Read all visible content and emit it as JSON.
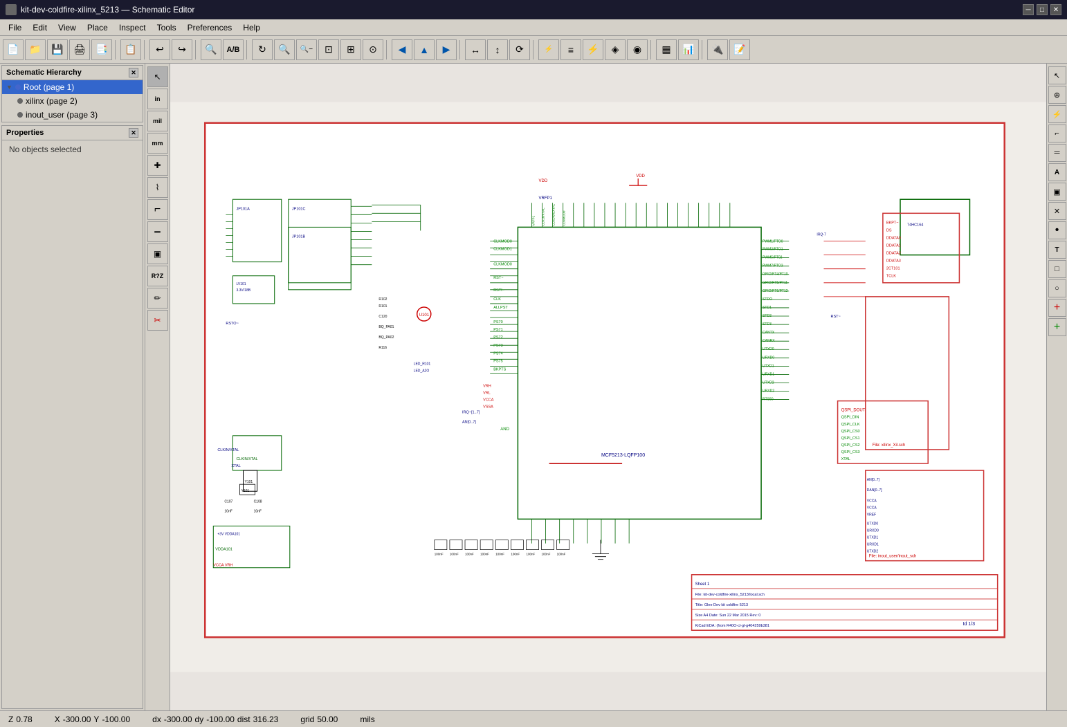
{
  "titlebar": {
    "title": "kit-dev-coldfire-xilinx_5213 — Schematic Editor",
    "icon": "schematic-icon",
    "controls": [
      "minimize",
      "maximize",
      "close"
    ]
  },
  "menubar": {
    "items": [
      "File",
      "Edit",
      "View",
      "Place",
      "Inspect",
      "Tools",
      "Preferences",
      "Help"
    ]
  },
  "toolbar": {
    "buttons": [
      {
        "name": "new",
        "icon": "📄",
        "label": "New"
      },
      {
        "name": "open",
        "icon": "📁",
        "label": "Open"
      },
      {
        "name": "save",
        "icon": "💾",
        "label": "Save"
      },
      {
        "name": "print",
        "icon": "🖨",
        "label": "Print"
      },
      {
        "name": "pdf",
        "icon": "📑",
        "label": "PDF"
      },
      {
        "name": "copy",
        "icon": "📋",
        "label": "Copy"
      },
      {
        "name": "undo",
        "icon": "↩",
        "label": "Undo"
      },
      {
        "name": "redo",
        "icon": "↪",
        "label": "Redo"
      },
      {
        "name": "search",
        "icon": "🔍",
        "label": "Search"
      },
      {
        "name": "annotate",
        "icon": "A",
        "label": "Annotate"
      },
      {
        "name": "refresh",
        "icon": "↻",
        "label": "Refresh"
      },
      {
        "name": "zoom-in",
        "icon": "+",
        "label": "Zoom In"
      },
      {
        "name": "zoom-out",
        "icon": "−",
        "label": "Zoom Out"
      },
      {
        "name": "zoom-fit",
        "icon": "⊡",
        "label": "Zoom Fit"
      },
      {
        "name": "zoom-area",
        "icon": "⊞",
        "label": "Zoom Area"
      },
      {
        "name": "zoom-orig",
        "icon": "⊙",
        "label": "Zoom Original"
      },
      {
        "name": "nav-left",
        "icon": "◀",
        "label": "Navigate Left"
      },
      {
        "name": "nav-up",
        "icon": "▲",
        "label": "Navigate Up"
      },
      {
        "name": "nav-right",
        "icon": "▶",
        "label": "Navigate Right"
      },
      {
        "name": "mirror-x",
        "icon": "↔",
        "label": "Mirror X"
      },
      {
        "name": "mirror-y",
        "icon": "↕",
        "label": "Mirror Y"
      },
      {
        "name": "rotate",
        "icon": "⟳",
        "label": "Rotate"
      },
      {
        "name": "sym1",
        "icon": "⊕",
        "label": "Symbol 1"
      },
      {
        "name": "sym2",
        "icon": "⊗",
        "label": "Symbol 2"
      },
      {
        "name": "hier",
        "icon": "🗂",
        "label": "Hierarchy"
      },
      {
        "name": "netlist",
        "icon": "≡",
        "label": "Netlist"
      },
      {
        "name": "erc",
        "icon": "⚡",
        "label": "ERC"
      },
      {
        "name": "sym3",
        "icon": "◈",
        "label": "Symbol 3"
      },
      {
        "name": "sym4",
        "icon": "◉",
        "label": "Symbol 4"
      },
      {
        "name": "sym5",
        "icon": "⊟",
        "label": "Symbol 5"
      },
      {
        "name": "fields",
        "icon": "▦",
        "label": "Fields"
      },
      {
        "name": "bom",
        "icon": "📊",
        "label": "BOM"
      },
      {
        "name": "pcb",
        "icon": "🔌",
        "label": "PCB"
      },
      {
        "name": "script",
        "icon": "📝",
        "label": "Script"
      }
    ]
  },
  "schematic_hierarchy": {
    "title": "Schematic Hierarchy",
    "items": [
      {
        "id": "root",
        "label": "Root (page 1)",
        "level": 0,
        "selected": true,
        "expanded": true
      },
      {
        "id": "xilinx",
        "label": "xilinx (page 2)",
        "level": 1,
        "selected": false,
        "expanded": false
      },
      {
        "id": "inout_user",
        "label": "inout_user (page 3)",
        "level": 1,
        "selected": false,
        "expanded": false
      }
    ]
  },
  "properties": {
    "title": "Properties",
    "content": "No objects selected"
  },
  "vert_toolbar": {
    "buttons": [
      {
        "name": "select",
        "icon": "↖",
        "label": "Select"
      },
      {
        "name": "unit-in",
        "text": "in",
        "label": "Inches"
      },
      {
        "name": "unit-mil",
        "text": "mil",
        "label": "Mils"
      },
      {
        "name": "unit-mm",
        "text": "mm",
        "label": "Millimeters"
      },
      {
        "name": "add-sym",
        "icon": "♦",
        "label": "Add Symbol"
      },
      {
        "name": "add-power",
        "icon": "⚡",
        "label": "Add Power"
      },
      {
        "name": "add-wire",
        "icon": "⌐",
        "label": "Add Wire"
      },
      {
        "name": "add-bus",
        "icon": "═",
        "label": "Add Bus"
      },
      {
        "name": "add-hier",
        "icon": "▣",
        "label": "Add Hierarchy"
      },
      {
        "name": "rz-tool",
        "text": "R?",
        "label": "Reannotate"
      },
      {
        "name": "edit-sym",
        "icon": "✏",
        "label": "Edit Symbol"
      },
      {
        "name": "delete",
        "icon": "✂",
        "label": "Delete"
      }
    ]
  },
  "right_toolbar": {
    "buttons": [
      {
        "name": "rt-select",
        "icon": "↖",
        "label": "Select Mode"
      },
      {
        "name": "rt-sym",
        "icon": "⊕",
        "label": "Add Symbol"
      },
      {
        "name": "rt-power",
        "icon": "⚡",
        "label": "Power"
      },
      {
        "name": "rt-wire",
        "icon": "⌐",
        "label": "Wire"
      },
      {
        "name": "rt-bus",
        "icon": "═",
        "label": "Bus"
      },
      {
        "name": "rt-label",
        "icon": "A",
        "label": "Label"
      },
      {
        "name": "rt-hier",
        "icon": "▣",
        "label": "Hierarchy"
      },
      {
        "name": "rt-noconn",
        "icon": "✕",
        "label": "No Connect"
      },
      {
        "name": "rt-junc",
        "icon": "●",
        "label": "Junction"
      },
      {
        "name": "rt-text",
        "icon": "T",
        "label": "Text"
      },
      {
        "name": "rt-rect",
        "icon": "□",
        "label": "Rectangle"
      },
      {
        "name": "rt-circle",
        "icon": "○",
        "label": "Circle"
      },
      {
        "name": "rt-add-red",
        "icon": "+",
        "label": "Add Red",
        "color": "red"
      },
      {
        "name": "rt-add-green",
        "icon": "+",
        "label": "Add Green",
        "color": "green"
      }
    ]
  },
  "statusbar": {
    "zoom": {
      "label": "Z",
      "value": "0.78"
    },
    "x_coord": {
      "label": "X",
      "value": "-300.00"
    },
    "y_coord": {
      "label": "Y",
      "value": "-100.00"
    },
    "dx": {
      "label": "dx",
      "value": "-300.00"
    },
    "dy": {
      "label": "dy",
      "value": "-100.00"
    },
    "dist": {
      "label": "dist",
      "value": "316.23"
    },
    "grid": {
      "label": "grid",
      "value": "50.00"
    },
    "unit": {
      "value": "mils"
    }
  },
  "schematic": {
    "title": "Schematic Canvas",
    "components": "Complex KiCad schematic with multiple ICs, connectors, and wiring"
  }
}
